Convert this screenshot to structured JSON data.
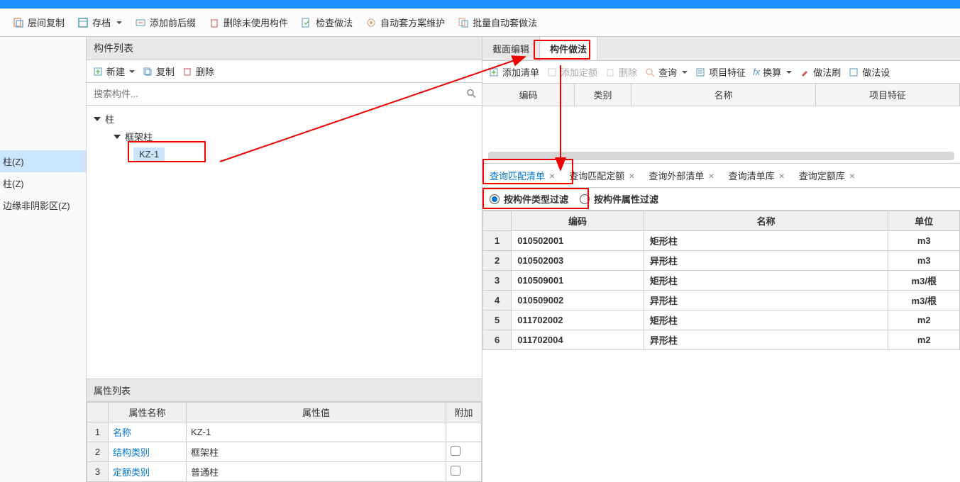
{
  "toolbar": {
    "copyLayer": "层间复制",
    "archive": "存档",
    "addPrefixSuffix": "添加前后缀",
    "deleteUnused": "删除未使用构件",
    "checkMethod": "检查做法",
    "autoMaintain": "自动套方案维护",
    "batchAuto": "批量自动套做法"
  },
  "leftSidebar": {
    "items": [
      "柱(Z)",
      "柱(Z)",
      "边缘非阴影区(Z)"
    ]
  },
  "componentList": {
    "title": "构件列表",
    "newBtn": "新建",
    "copyBtn": "复制",
    "deleteBtn": "删除",
    "searchPlaceholder": "搜索构件...",
    "tree": {
      "root": "柱",
      "child1": "框架柱",
      "leaf": "KZ-1"
    }
  },
  "propList": {
    "title": "属性列表",
    "headers": [
      "属性名称",
      "属性值",
      "附加"
    ],
    "rows": [
      {
        "n": "1",
        "name": "名称",
        "value": "KZ-1",
        "link": true
      },
      {
        "n": "2",
        "name": "结构类别",
        "value": "框架柱",
        "link": true,
        "check": true
      },
      {
        "n": "3",
        "name": "定额类别",
        "value": "普通柱",
        "link": true,
        "check": true
      }
    ]
  },
  "rightTabs": {
    "tab1": "截面编辑",
    "tab2": "构件做法"
  },
  "rightToolbar": {
    "addList": "添加清单",
    "addQuota": "添加定额",
    "delete": "删除",
    "query": "查询",
    "projectFeature": "项目特征",
    "convert": "换算",
    "methodBrush": "做法刷",
    "methodMore": "做法设"
  },
  "rightHeaders": {
    "code": "编码",
    "category": "类别",
    "name": "名称",
    "feature": "项目特征"
  },
  "queryTabs": {
    "t1": "查询匹配清单",
    "t2": "查询匹配定额",
    "t3": "查询外部清单",
    "t4": "查询清单库",
    "t5": "查询定额库"
  },
  "filters": {
    "byType": "按构件类型过滤",
    "byProp": "按构件属性过滤"
  },
  "resultHeaders": {
    "code": "编码",
    "name": "名称",
    "unit": "单位"
  },
  "results": [
    {
      "n": "1",
      "code": "010502001",
      "name": "矩形柱",
      "unit": "m3"
    },
    {
      "n": "2",
      "code": "010502003",
      "name": "异形柱",
      "unit": "m3"
    },
    {
      "n": "3",
      "code": "010509001",
      "name": "矩形柱",
      "unit": "m3/根"
    },
    {
      "n": "4",
      "code": "010509002",
      "name": "异形柱",
      "unit": "m3/根"
    },
    {
      "n": "5",
      "code": "011702002",
      "name": "矩形柱",
      "unit": "m2"
    },
    {
      "n": "6",
      "code": "011702004",
      "name": "异形柱",
      "unit": "m2"
    }
  ]
}
